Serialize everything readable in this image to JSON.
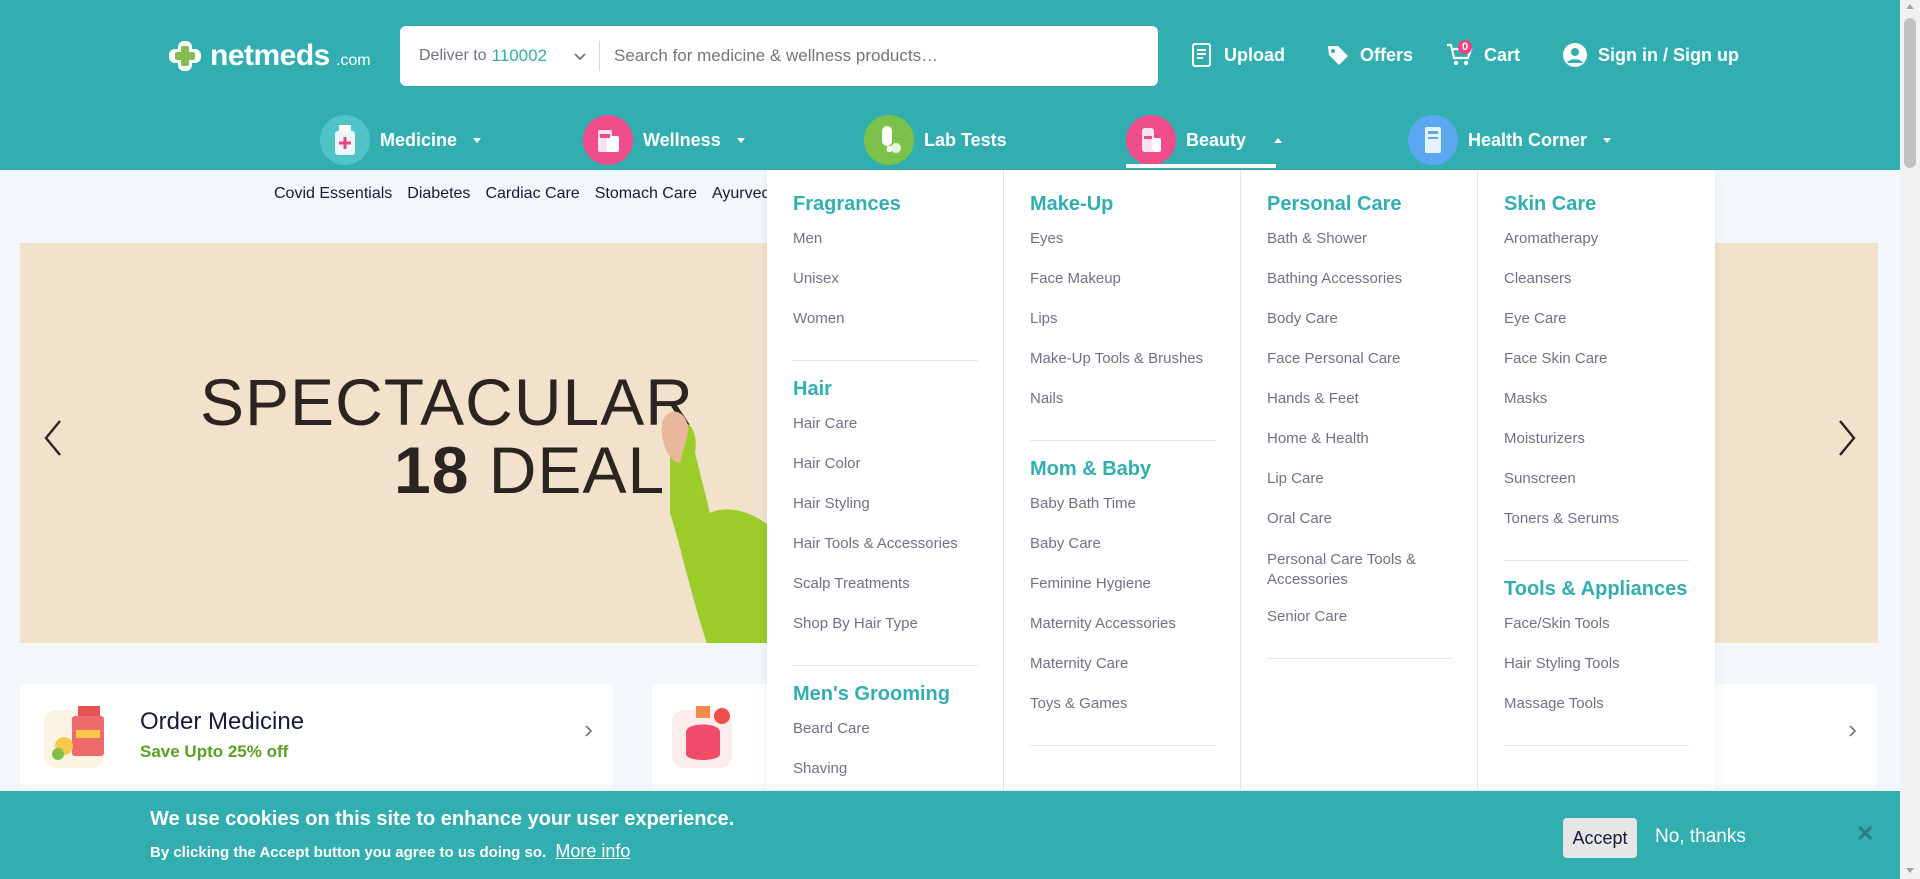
{
  "header": {
    "logo_text": "netmeds",
    "logo_suffix": ".com",
    "deliver_label": "Deliver to",
    "pincode": "110002",
    "search_placeholder": "Search for medicine & wellness products…",
    "upload_label": "Upload",
    "offers_label": "Offers",
    "cart_label": "Cart",
    "cart_count": "0",
    "signin_label": "Sign in / Sign up"
  },
  "catnav": {
    "medicine": "Medicine",
    "wellness": "Wellness",
    "labtests": "Lab Tests",
    "beauty": "Beauty",
    "health_corner": "Health Corner"
  },
  "subcats": [
    "Covid Essentials",
    "Diabetes",
    "Cardiac Care",
    "Stomach Care",
    "Ayurvedi"
  ],
  "banner": {
    "line1": "SPECTACULAR",
    "line2_num": "18",
    "line2_text": "DEAL"
  },
  "cards": {
    "order_title": "Order Medicine",
    "order_sub": "Save Upto 25% off"
  },
  "mega": {
    "fragrances": {
      "title": "Fragrances",
      "items": [
        "Men",
        "Unisex",
        "Women"
      ]
    },
    "hair": {
      "title": "Hair",
      "items": [
        "Hair Care",
        "Hair Color",
        "Hair Styling",
        "Hair Tools & Accessories",
        "Scalp Treatments",
        "Shop By Hair Type"
      ]
    },
    "mens_grooming": {
      "title": "Men's Grooming",
      "items": [
        "Beard Care",
        "Shaving"
      ]
    },
    "makeup": {
      "title": "Make-Up",
      "items": [
        "Eyes",
        "Face Makeup",
        "Lips",
        "Make-Up Tools & Brushes",
        "Nails"
      ]
    },
    "mom_baby": {
      "title": "Mom & Baby",
      "items": [
        "Baby Bath Time",
        "Baby Care",
        "Feminine Hygiene",
        "Maternity Accessories",
        "Maternity Care",
        "Toys & Games"
      ]
    },
    "personal_care": {
      "title": "Personal Care",
      "items": [
        "Bath & Shower",
        "Bathing Accessories",
        "Body Care",
        "Face Personal Care",
        "Hands & Feet",
        "Home & Health",
        "Lip Care",
        "Oral Care",
        "Personal Care Tools & Accessories",
        "Senior Care"
      ]
    },
    "skin_care": {
      "title": "Skin Care",
      "items": [
        "Aromatherapy",
        "Cleansers",
        "Eye Care",
        "Face Skin Care",
        "Masks",
        "Moisturizers",
        "Sunscreen",
        "Toners & Serums"
      ]
    },
    "tools": {
      "title": "Tools & Appliances",
      "items": [
        "Face/Skin Tools",
        "Hair Styling Tools",
        "Massage Tools"
      ]
    }
  },
  "cookie": {
    "heading": "We use cookies on this site to enhance your user experience.",
    "sub": "By clicking the Accept button you agree to us doing so.",
    "more_info": "More info",
    "accept": "Accept",
    "no_thanks": "No, thanks",
    "close": "✕"
  },
  "colors": {
    "brand_teal": "#32aeb1",
    "text_dark": "#151b39",
    "text_gray": "#6f7284",
    "green": "#59a026",
    "badge_pink": "#ef4281"
  },
  "icons": {
    "upload": "prescription-upload-icon",
    "offers": "tag-icon",
    "cart": "cart-icon",
    "user": "user-icon",
    "chev_down": "chevron-down-icon",
    "prev": "chevron-left-icon",
    "next": "chevron-right-icon"
  }
}
